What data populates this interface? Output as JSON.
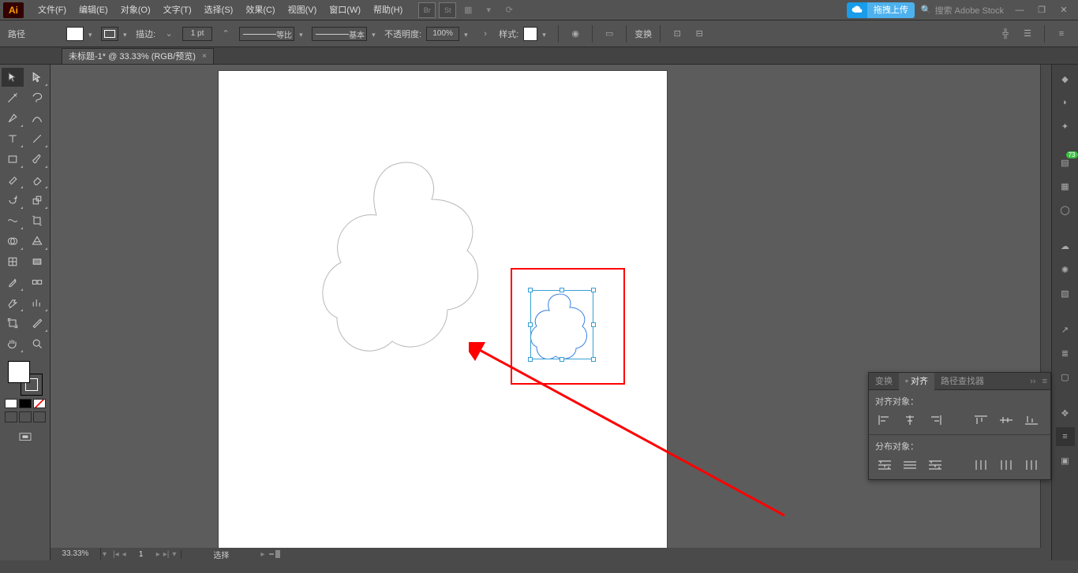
{
  "app": {
    "logo": "Ai"
  },
  "menu": {
    "file": "文件(F)",
    "edit": "编辑(E)",
    "object": "对象(O)",
    "text": "文字(T)",
    "select": "选择(S)",
    "effect": "效果(C)",
    "view": "视图(V)",
    "window": "窗口(W)",
    "help": "帮助(H)"
  },
  "topright": {
    "upload": "拖拽上传",
    "search_placeholder": "搜索 Adobe Stock"
  },
  "ctrl": {
    "path_label": "路径",
    "stroke_label": "描边:",
    "pt_value": "1 pt",
    "profile_label": "等比",
    "brush_label": "基本",
    "opacity_label": "不透明度:",
    "opacity_value": "100%",
    "style_label": "样式:",
    "transform_label": "变换"
  },
  "doc": {
    "tab_title": "未标题-1* @ 33.33% (RGB/预览)"
  },
  "status": {
    "zoom": "33.33%",
    "page": "1",
    "mode": "选择"
  },
  "panel": {
    "tab_transform": "变换",
    "tab_align": "对齐",
    "tab_pathfinder": "路径查找器",
    "section_align": "对齐对象：",
    "section_dist": "分布对象："
  },
  "badge": {
    "count": "73"
  }
}
